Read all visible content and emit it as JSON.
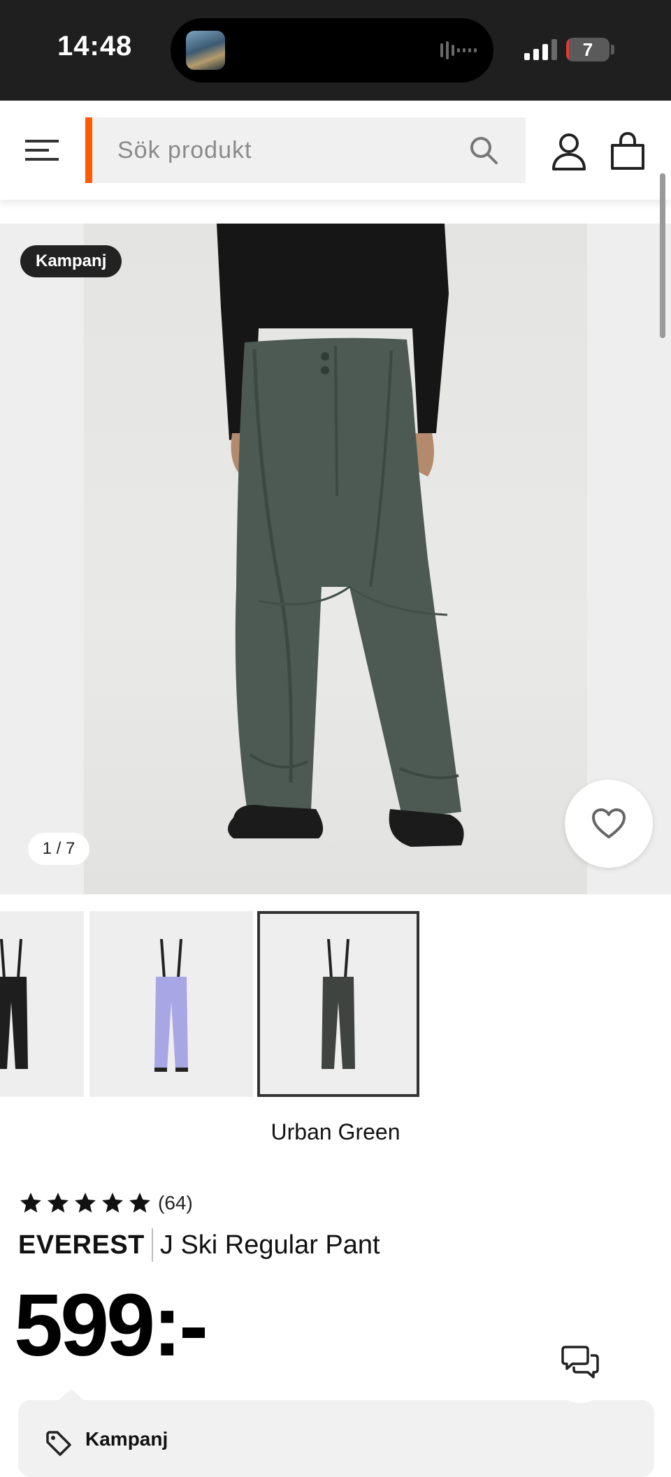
{
  "status_bar": {
    "time": "14:48",
    "battery_level": "7",
    "battery_fraction": 0.07,
    "background_color": "#1f1f1f"
  },
  "header": {
    "search": {
      "placeholder": "Sök produkt"
    },
    "accent_color": "#ff5a00",
    "icons": [
      "hamburger-menu-icon",
      "search-icon",
      "user-icon",
      "shopping-bag-icon"
    ]
  },
  "gallery": {
    "badge": "Kampanj",
    "counter": "1 / 7",
    "current_image": 1,
    "total_images": 7,
    "favorite_icon": "heart-icon"
  },
  "variants": {
    "items": [
      {
        "color_hex": "#1e1e1e",
        "selected": false
      },
      {
        "color_hex": "#a9a6e6",
        "selected": false
      },
      {
        "color_hex": "#3f4440",
        "selected": true
      }
    ],
    "selected_color_name": "Urban Green"
  },
  "product": {
    "rating_stars": 5,
    "rating_count": "(64)",
    "brand": "EVEREST",
    "name": "J Ski Regular Pant",
    "price": "599:-"
  },
  "promo": {
    "label": "Kampanj",
    "icon": "price-tag-icon"
  },
  "chat": {
    "icon": "chat-bubbles-icon"
  }
}
